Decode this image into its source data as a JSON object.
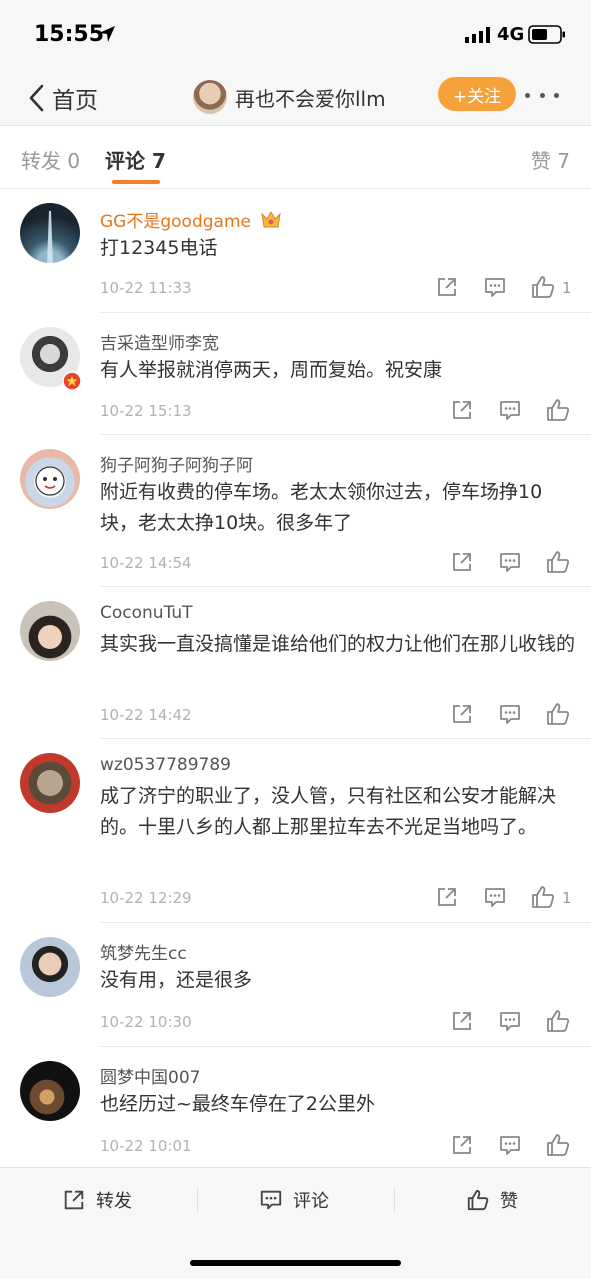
{
  "status": {
    "time": "15:55",
    "network": "4G"
  },
  "nav": {
    "back_label": "首页",
    "user_name": "再也不会爱你llm",
    "follow_label": "+关注"
  },
  "tabs": {
    "reposts": "转发 0",
    "comments": "评论 7",
    "likes": "赞 7"
  },
  "comments": [
    {
      "user": "GG不是goodgame",
      "text": "打12345电话",
      "time": "10-22 11:33",
      "likes": "1"
    },
    {
      "user": "吉采造型师李宽",
      "text": "有人举报就消停两天，周而复始。祝安康",
      "time": "10-22 15:13",
      "likes": ""
    },
    {
      "user": "狗子阿狗子阿狗子阿",
      "text": "附近有收费的停车场。老太太领你过去，停车场挣10块，老太太挣10块。很多年了",
      "time": "10-22 14:54",
      "likes": ""
    },
    {
      "user": "CoconuTuT",
      "text": "其实我一直没搞懂是谁给他们的权力让他们在那儿收钱的",
      "time": "10-22 14:42",
      "likes": ""
    },
    {
      "user": "wz0537789789",
      "text": "成了济宁的职业了，没人管，只有社区和公安才能解决的。十里八乡的人都上那里拉车去不光足当地吗了。",
      "time": "10-22 12:29",
      "likes": "1"
    },
    {
      "user": "筑梦先生cc",
      "text": "没有用，还是很多",
      "time": "10-22 10:30",
      "likes": ""
    },
    {
      "user": "圆梦中国007",
      "text": "也经历过~最终车停在了2公里外",
      "time": "10-22 10:01",
      "likes": ""
    }
  ],
  "toolbar": {
    "repost": "转发",
    "comment": "评论",
    "like": "赞"
  },
  "colors": {
    "accent": "#f47c2a",
    "follow": "#f7a13a",
    "vip_name": "#e8761f"
  }
}
